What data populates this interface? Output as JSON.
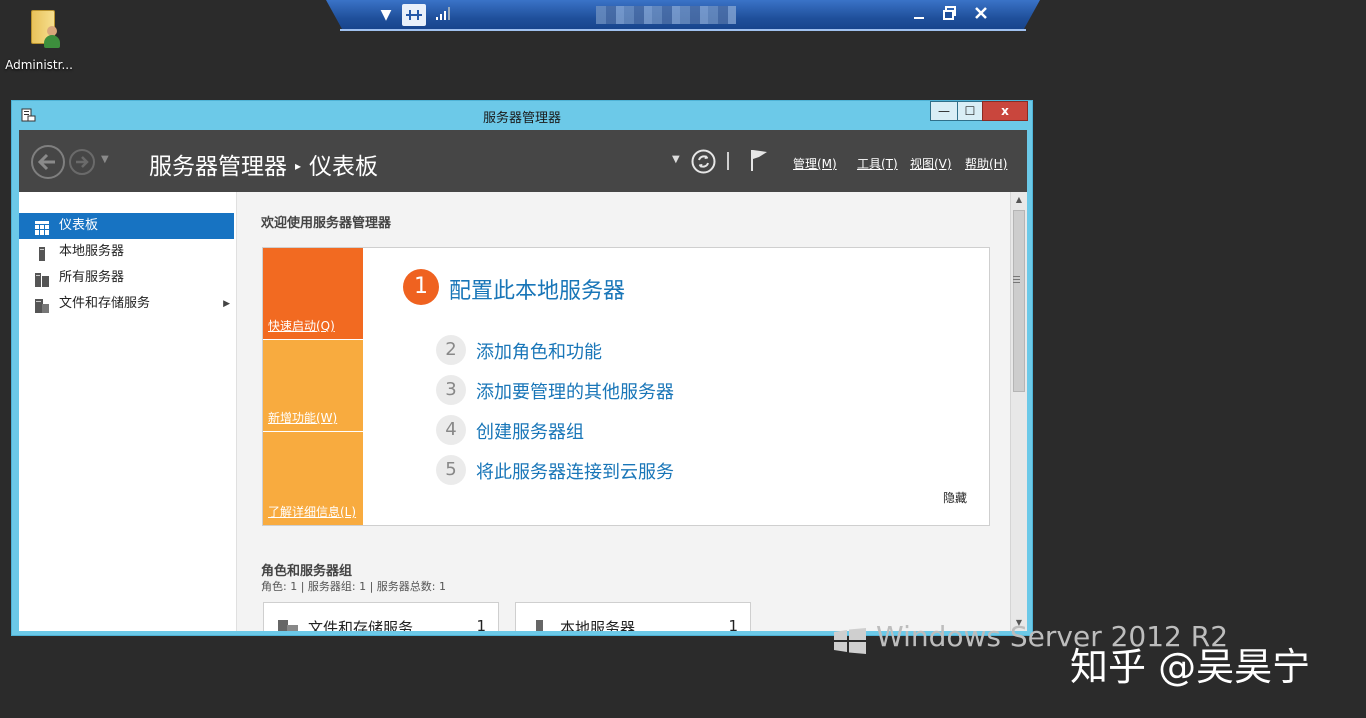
{
  "desktop": {
    "icon_label": "Administr..."
  },
  "rdbar": {
    "icons": [
      "chevron-down-icon",
      "pin-icon",
      "signal-icon",
      "minimize-icon",
      "restore-icon",
      "close-icon"
    ]
  },
  "window": {
    "title": "服务器管理器",
    "buttons": {
      "minimize": "—",
      "maximize": "☐",
      "close": "x"
    }
  },
  "header": {
    "breadcrumb_root": "服务器管理器",
    "breadcrumb_sep": "▸",
    "breadcrumb_current": "仪表板",
    "menus": [
      "管理(M)",
      "工具(T)",
      "视图(V)",
      "帮助(H)"
    ]
  },
  "sidebar": {
    "items": [
      {
        "label": "仪表板",
        "icon": "dashboard-icon",
        "active": true
      },
      {
        "label": "本地服务器",
        "icon": "server-icon"
      },
      {
        "label": "所有服务器",
        "icon": "servers-icon"
      },
      {
        "label": "文件和存储服务",
        "icon": "storage-icon",
        "has_arrow": true
      }
    ]
  },
  "main": {
    "welcome_title": "欢迎使用服务器管理器",
    "tiles": [
      {
        "label": "快速启动(Q)",
        "color": "#f26a21"
      },
      {
        "label": "新增功能(W)",
        "color": "#f8ab3f"
      },
      {
        "label": "了解详细信息(L)",
        "color": "#f8ab3f"
      }
    ],
    "steps": [
      {
        "num": "1",
        "label": "配置此本地服务器"
      },
      {
        "num": "2",
        "label": "添加角色和功能"
      },
      {
        "num": "3",
        "label": "添加要管理的其他服务器"
      },
      {
        "num": "4",
        "label": "创建服务器组"
      },
      {
        "num": "5",
        "label": "将此服务器连接到云服务"
      }
    ],
    "hide_label": "隐藏",
    "roles_title": "角色和服务器组",
    "roles_subtitle": "角色: 1 | 服务器组: 1 | 服务器总数: 1",
    "cards": [
      {
        "title": "文件和存储服务",
        "count": "1"
      },
      {
        "title": "本地服务器",
        "count": "1"
      }
    ]
  },
  "watermarks": {
    "windows_server": "Windows Server 2012 R2",
    "zhihu": "知乎 @吴昊宁"
  },
  "colors": {
    "accent": "#1773c2",
    "header": "#464646",
    "orange": "#f26a21",
    "amber": "#f8ab3f",
    "window_frame": "#6cc9e8"
  }
}
